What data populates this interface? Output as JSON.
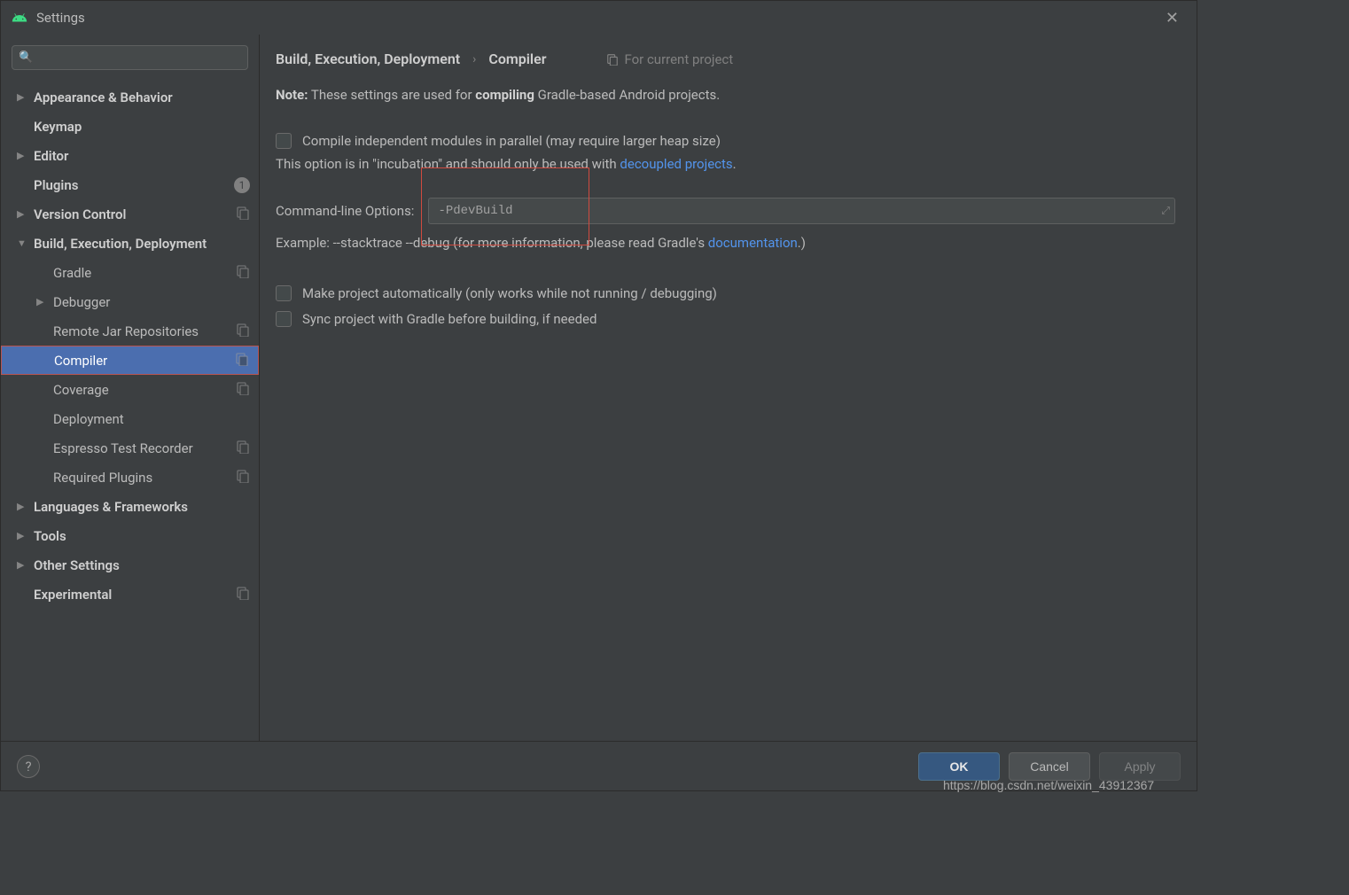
{
  "window": {
    "title": "Settings"
  },
  "search": {
    "placeholder": ""
  },
  "sidebar": {
    "items": [
      {
        "label": "Appearance & Behavior",
        "bold": true,
        "arrow": "right"
      },
      {
        "label": "Keymap",
        "bold": true
      },
      {
        "label": "Editor",
        "bold": true,
        "arrow": "right"
      },
      {
        "label": "Plugins",
        "bold": true,
        "badge": "1"
      },
      {
        "label": "Version Control",
        "bold": true,
        "arrow": "right",
        "copy": true
      },
      {
        "label": "Build, Execution, Deployment",
        "bold": true,
        "arrow": "down"
      },
      {
        "label": "Gradle",
        "child": true,
        "copy": true
      },
      {
        "label": "Debugger",
        "child": true,
        "arrow": "right"
      },
      {
        "label": "Remote Jar Repositories",
        "child": true,
        "copy": true
      },
      {
        "label": "Compiler",
        "child": true,
        "copy": true,
        "selected": true
      },
      {
        "label": "Coverage",
        "child": true,
        "copy": true
      },
      {
        "label": "Deployment",
        "child": true
      },
      {
        "label": "Espresso Test Recorder",
        "child": true,
        "copy": true
      },
      {
        "label": "Required Plugins",
        "child": true,
        "copy": true
      },
      {
        "label": "Languages & Frameworks",
        "bold": true,
        "arrow": "right"
      },
      {
        "label": "Tools",
        "bold": true,
        "arrow": "right"
      },
      {
        "label": "Other Settings",
        "bold": true,
        "arrow": "right"
      },
      {
        "label": "Experimental",
        "bold": true,
        "copy": true
      }
    ]
  },
  "content": {
    "breadcrumb": {
      "parent": "Build, Execution, Deployment",
      "current": "Compiler",
      "scope": "For current project"
    },
    "note": {
      "prefix": "Note:",
      "text1": " These settings are used for ",
      "bold": "compiling",
      "text2": " Gradle-based Android projects."
    },
    "cbx_parallel": "Compile independent modules in parallel (may require larger heap size)",
    "incubation": {
      "pre": "This option is in \"incubation\" and should only be used with ",
      "link": "decoupled projects",
      "post": "."
    },
    "cmd_label": "Command-line Options:",
    "cmd_value": "-PdevBuild",
    "example": {
      "pre": "Example: --stacktrace --debug (for more information, please read Gradle's ",
      "link": "documentation",
      "post": ".)"
    },
    "cbx_auto": "Make project automatically (only works while not running / debugging)",
    "cbx_sync": "Sync project with Gradle before building, if needed"
  },
  "footer": {
    "ok": "OK",
    "cancel": "Cancel",
    "apply": "Apply"
  },
  "watermark": "https://blog.csdn.net/weixin_43912367"
}
